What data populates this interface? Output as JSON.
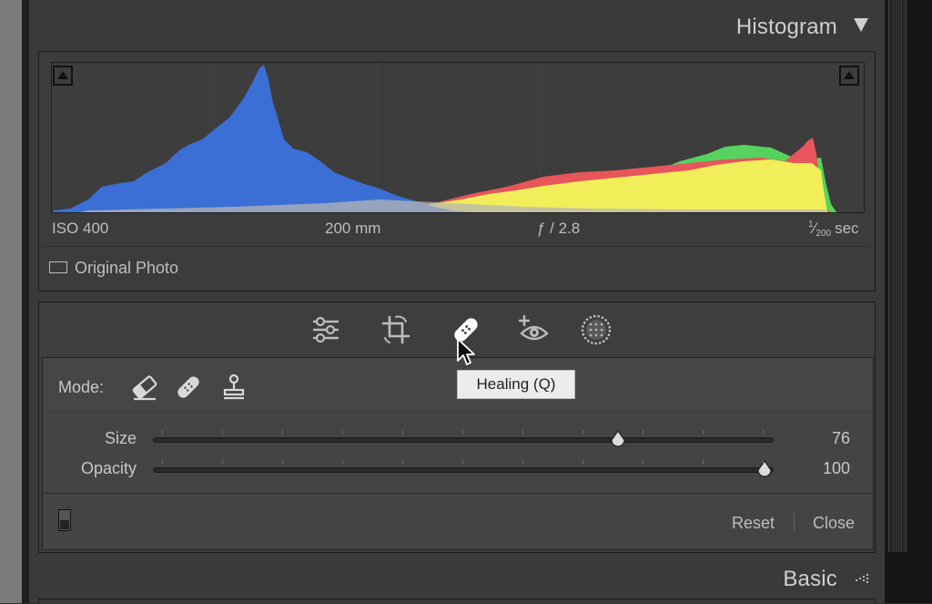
{
  "histogram": {
    "title": "Histogram",
    "exif": {
      "iso": "ISO 400",
      "focal_length": "200 mm",
      "aperture": "ƒ / 2.8",
      "shutter_numerator": "1",
      "shutter_denominator": "200",
      "shutter_unit": "sec"
    },
    "original_photo_label": "Original Photo",
    "colors": {
      "blue": "#3b6fd6",
      "yellow": "#f2ee5a",
      "red": "#e8555a",
      "green": "#55d35e",
      "gray": "#b5b5b5"
    }
  },
  "toolbar": {
    "tools": [
      "sliders-icon",
      "crop-icon",
      "bandage-icon",
      "red-eye-icon",
      "masking-icon"
    ],
    "active": "bandage-icon"
  },
  "tooltip": {
    "text": "Healing (Q)"
  },
  "healing_panel": {
    "mode_label": "Mode:",
    "modes": [
      "eraser-icon",
      "bandage-icon",
      "stamp-icon"
    ],
    "size_label": "Size",
    "size_value": "76",
    "size_fraction": 0.76,
    "opacity_label": "Opacity",
    "opacity_value": "100",
    "opacity_fraction": 1.0,
    "reset_label": "Reset",
    "close_label": "Close"
  },
  "basic": {
    "title": "Basic"
  }
}
